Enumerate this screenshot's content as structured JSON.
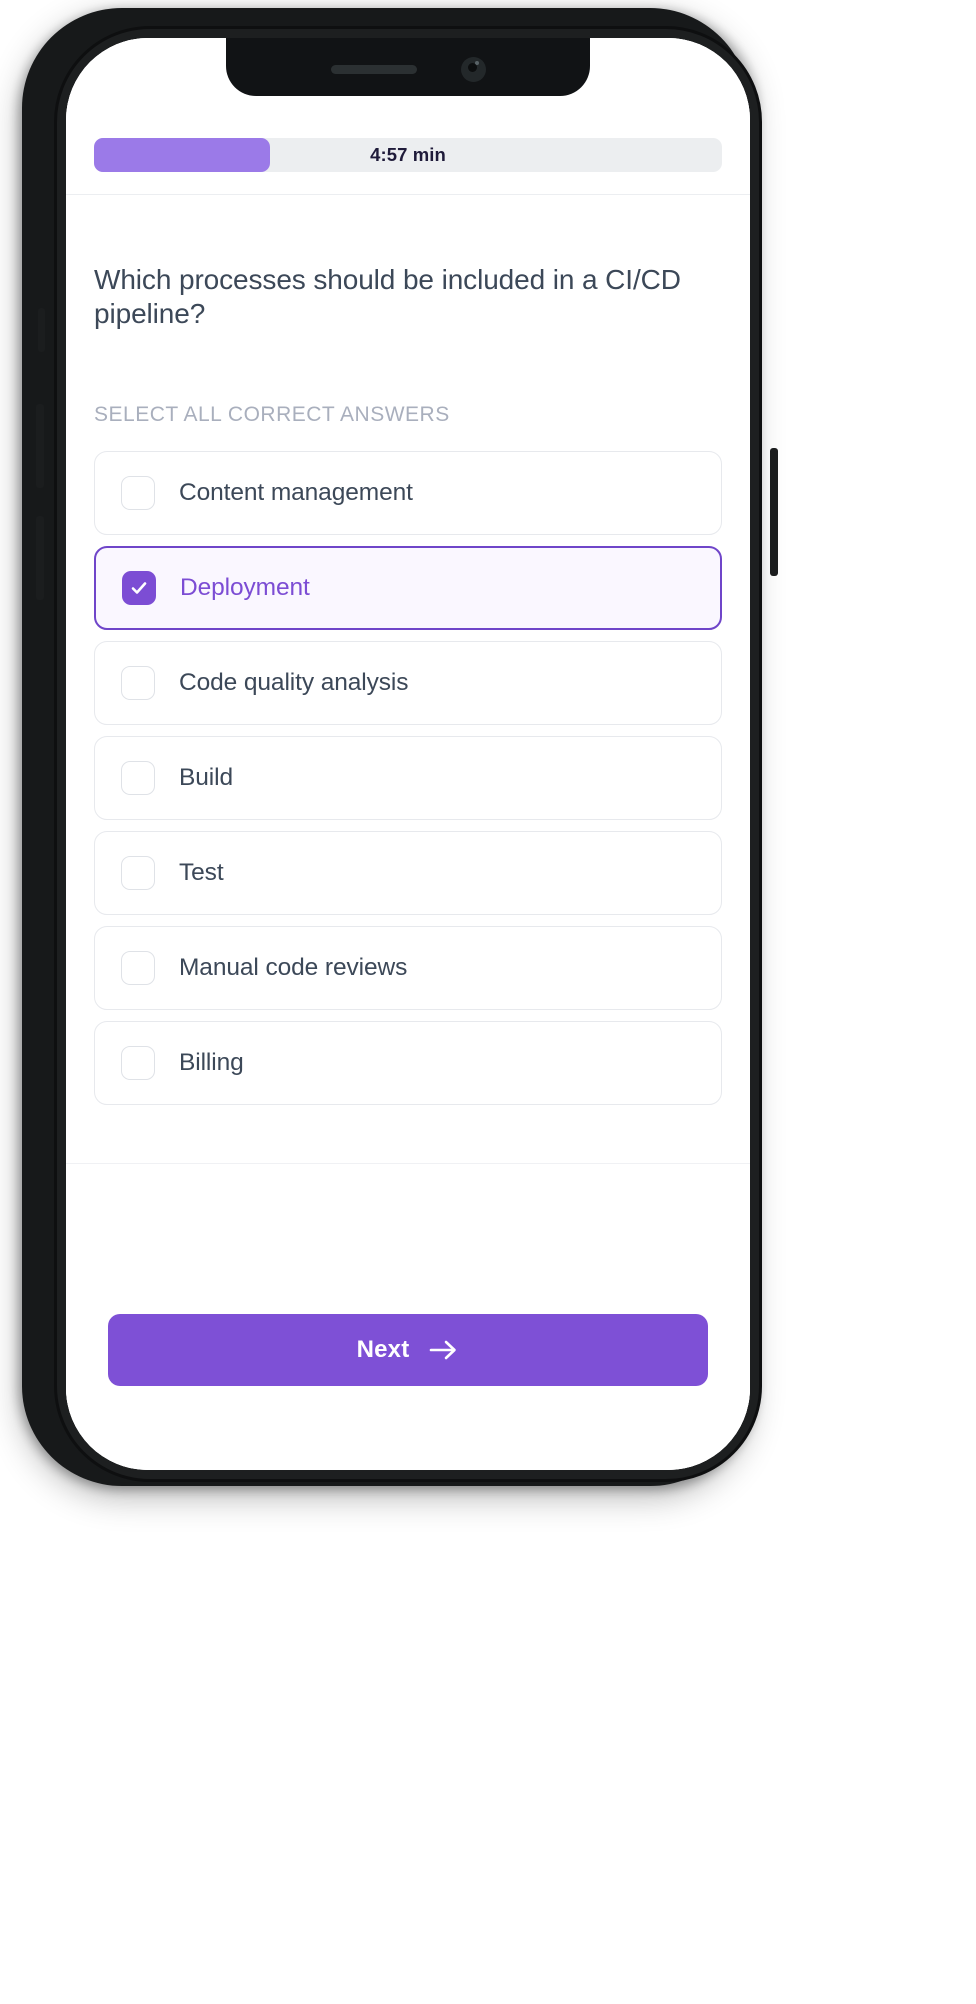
{
  "device": {
    "notch": {
      "speaker": "speaker-slot",
      "camera": "front-camera"
    }
  },
  "quiz": {
    "progress": {
      "time_label": "4:57 min",
      "fill_percent": 28,
      "fill_color": "#9b7ae8",
      "track_color": "#eceef0"
    },
    "question": "Which processes should be included in a CI/CD pipeline?",
    "instruction": "SELECT ALL CORRECT ANSWERS",
    "options": [
      {
        "label": "Content management",
        "selected": false
      },
      {
        "label": "Deployment",
        "selected": true
      },
      {
        "label": "Code quality analysis",
        "selected": false
      },
      {
        "label": "Build",
        "selected": false
      },
      {
        "label": "Test",
        "selected": false
      },
      {
        "label": "Manual code reviews",
        "selected": false
      },
      {
        "label": "Billing",
        "selected": false
      }
    ],
    "footer": {
      "next_label": "Next",
      "next_icon": "arrow-right-icon",
      "accent_color": "#7e50d6",
      "selected_border_color": "#6f45c9",
      "selected_background_color": "#faf7ff"
    }
  }
}
